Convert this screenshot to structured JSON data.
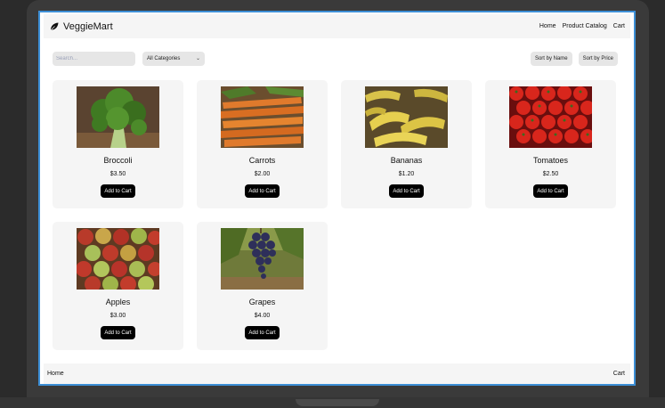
{
  "app": {
    "brand": "VeggieMart"
  },
  "nav": {
    "links": [
      "Home",
      "Product Catalog",
      "Cart"
    ]
  },
  "toolbar": {
    "search_placeholder": "Search...",
    "category_selected": "All Categories",
    "sort_name_label": "Sort by Name",
    "sort_price_label": "Sort by Price"
  },
  "products": [
    {
      "name": "Broccoli",
      "price": "$3.50",
      "button": "Add to Cart",
      "image": "broccoli"
    },
    {
      "name": "Carrots",
      "price": "$2.00",
      "button": "Add to Cart",
      "image": "carrots"
    },
    {
      "name": "Bananas",
      "price": "$1.20",
      "button": "Add to Cart",
      "image": "bananas"
    },
    {
      "name": "Tomatoes",
      "price": "$2.50",
      "button": "Add to Cart",
      "image": "tomatoes"
    },
    {
      "name": "Apples",
      "price": "$3.00",
      "button": "Add to Cart",
      "image": "apples"
    },
    {
      "name": "Grapes",
      "price": "$4.00",
      "button": "Add to Cart",
      "image": "grapes"
    }
  ],
  "footer": {
    "left_link": "Home",
    "right_link": "Cart"
  },
  "colors": {
    "accent_border": "#3d8fd6",
    "button_bg": "#000000",
    "card_bg": "#f5f5f5"
  }
}
